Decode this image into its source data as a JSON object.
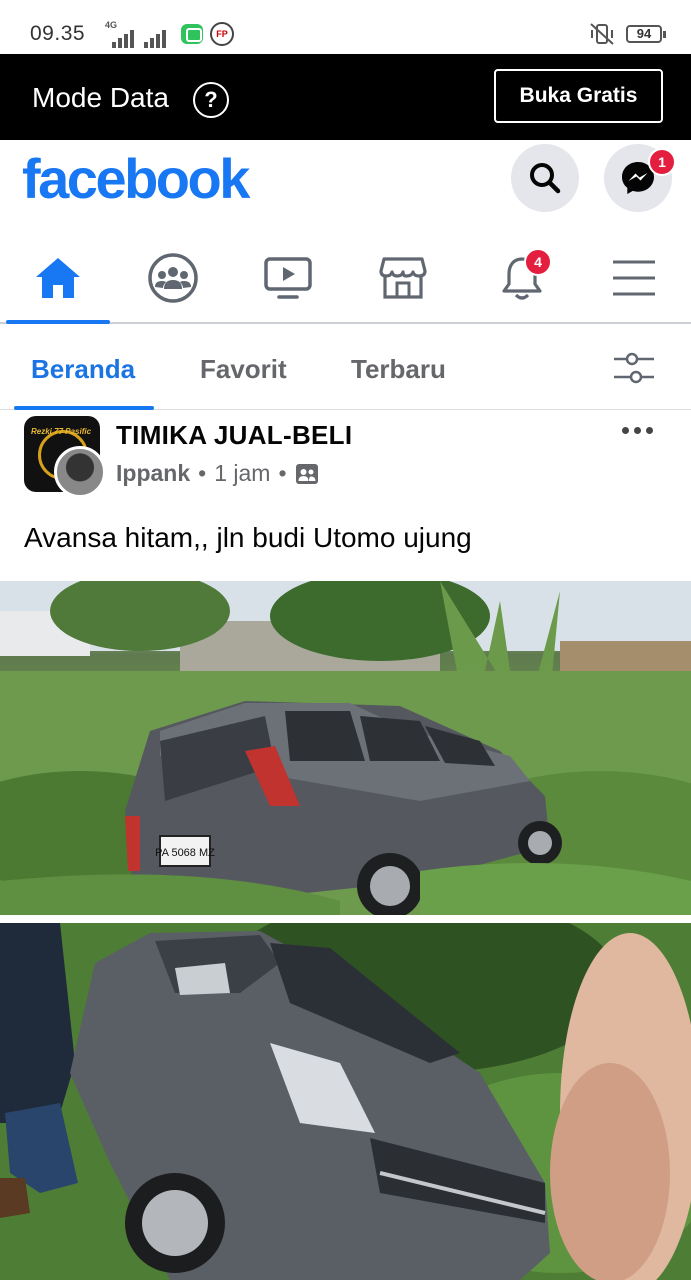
{
  "status_bar": {
    "time": "09.35",
    "network": "4G",
    "battery": "94"
  },
  "data_mode": {
    "title": "Mode Data",
    "help_icon": "question-circle",
    "free_button": "Buka Gratis"
  },
  "header": {
    "logo": "facebook",
    "brand_color": "#1877f2",
    "messenger_badge": "1"
  },
  "nav": {
    "items": [
      "home",
      "groups",
      "watch",
      "marketplace",
      "notifications",
      "menu"
    ],
    "notifications_badge": "4"
  },
  "feed_tabs": {
    "tabs": [
      "Beranda",
      "Favorit",
      "Terbaru"
    ],
    "active": "Beranda"
  },
  "post": {
    "group_name": "TIMIKA JUAL-BELI",
    "author": "Ippank",
    "time": "1 jam",
    "privacy_icon": "group-icon",
    "text": "Avansa hitam,, jln budi Utomo ujung",
    "group_avatar_text": "Rezki 77 Pasific",
    "plate": "PA 5068 MZ"
  }
}
